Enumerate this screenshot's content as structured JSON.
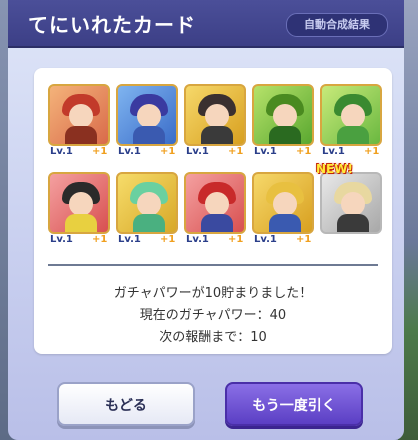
{
  "header": {
    "title": "てにいれたカード",
    "auto_button_label": "自動合成結果"
  },
  "cards": [
    {
      "level": "Lv.1",
      "plus": "+1",
      "new": ""
    },
    {
      "level": "Lv.1",
      "plus": "+1",
      "new": ""
    },
    {
      "level": "Lv.1",
      "plus": "+1",
      "new": ""
    },
    {
      "level": "Lv.1",
      "plus": "+1",
      "new": ""
    },
    {
      "level": "Lv.1",
      "plus": "+1",
      "new": ""
    },
    {
      "level": "Lv.1",
      "plus": "+1",
      "new": ""
    },
    {
      "level": "Lv.1",
      "plus": "+1",
      "new": ""
    },
    {
      "level": "Lv.1",
      "plus": "+1",
      "new": ""
    },
    {
      "level": "Lv.1",
      "plus": "+1",
      "new": ""
    },
    {
      "level": "",
      "plus": "",
      "new": "NEW!"
    }
  ],
  "messages": {
    "line1": "ガチャパワーが10貯まりました！",
    "line2": "現在のガチャパワー：40",
    "line3": "次の報酬まで：10"
  },
  "buttons": {
    "back_label": "もどる",
    "again_label": "もう一度引く"
  }
}
